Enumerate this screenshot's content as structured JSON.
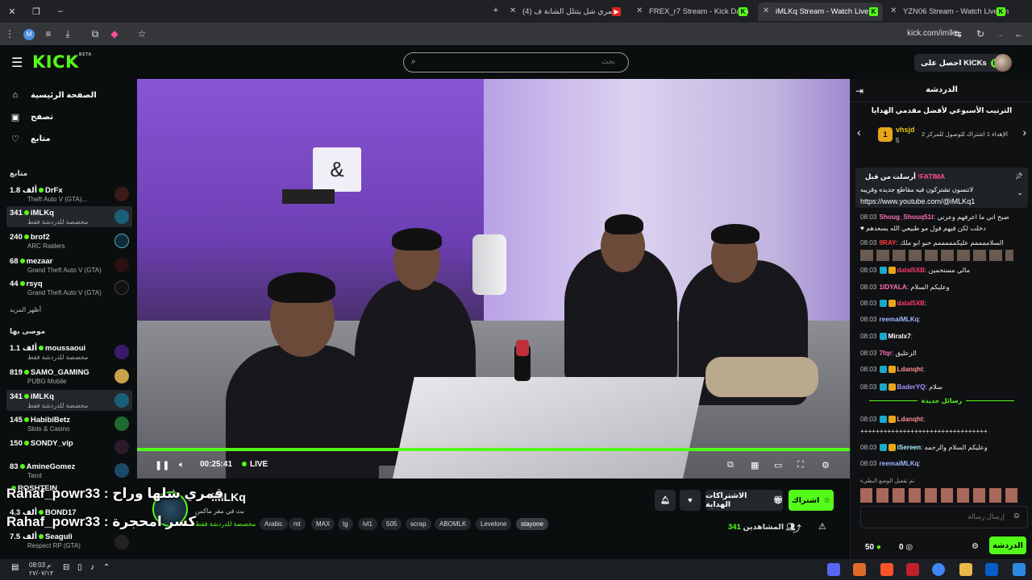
{
  "browser": {
    "tabs": [
      {
        "title": "قمري شل يتتلل الشانة ف (4)",
        "active": false
      },
      {
        "title": "FREX_r7 Stream - Kick Dash",
        "active": false
      },
      {
        "title": "iMLKq Stream - Watch Live",
        "active": true
      },
      {
        "title": "YZN06 Stream - Watch Live on",
        "active": false
      }
    ],
    "url": "kick.com/imlkq",
    "profile_initial": "M"
  },
  "header": {
    "logo": "KICK",
    "logo_beta": "BETA",
    "search_placeholder": "بحث",
    "get_kicks": "احصل على KICKs"
  },
  "sidebar": {
    "nav": [
      {
        "label": "الصفحة الرئيسية",
        "icon": "home-icon"
      },
      {
        "label": "تصفح",
        "icon": "browse-icon"
      },
      {
        "label": "متابع",
        "icon": "heart-icon"
      }
    ],
    "following_title": "متابع",
    "following": [
      {
        "viewers": "1.8 ألف",
        "name": "DrFx",
        "game": "Theft Auto V (GTA)...",
        "live": true
      },
      {
        "viewers": "341",
        "name": "iMLKq",
        "game": "مخصصة للدردشة فقط",
        "live": true,
        "selected": true
      },
      {
        "viewers": "240",
        "name": "brof2",
        "game": "ARC Raiders",
        "live": true
      },
      {
        "viewers": "68",
        "name": "mezaar",
        "game": "Grand Theft Auto V (GTA)",
        "live": true
      },
      {
        "viewers": "44",
        "name": "rsyq",
        "game": "Grand Theft Auto V (GTA)",
        "live": true
      }
    ],
    "show_more": "أظهر المزيد",
    "recommended_title": "موصى بها",
    "recommended": [
      {
        "viewers": "1.1 ألف",
        "name": "moussaoui",
        "game": "مخصصة للدردشة فقط"
      },
      {
        "viewers": "819",
        "name": "SAMO_GAMING",
        "game": "PUBG Mobile"
      },
      {
        "viewers": "341",
        "name": "iMLKq",
        "game": "مخصصة للدردشة فقط",
        "selected": true
      },
      {
        "viewers": "145",
        "name": "HabibiBetz",
        "game": "Slots & Casino"
      },
      {
        "viewers": "150",
        "name": "SONDY_vip",
        "game": ""
      },
      {
        "viewers": "83",
        "name": "AmineGomez",
        "game": "Tarot"
      },
      {
        "viewers": "",
        "name": "ROSHTEIN",
        "game": ""
      },
      {
        "viewers": "4.3 ألف",
        "name": "BOND17",
        "game": ""
      },
      {
        "viewers": "7.5 ألف",
        "name": "Seaguli",
        "game": "Respect RP (GTA)"
      }
    ]
  },
  "player": {
    "time": "00:25:41",
    "live_label": "LIVE",
    "progress": 1.0
  },
  "overlay": {
    "line1": "Rahaf_powr33 : قمري شلها وراح",
    "line2": "Rahaf_powr33 : كسر امحجرة"
  },
  "stream": {
    "channel": "iMLKq",
    "subtitle": "بث في مقر ماكس",
    "category": "مخصصة للدردشة فقط",
    "tags": [
      "Arabic",
      "mt",
      "MAX",
      "tg",
      "lvl1",
      "505",
      "scrap",
      "ABOMLK",
      "Levelone",
      "stayone"
    ],
    "subscribe": "اشتراك",
    "gift_subs": "الاشتراكات الهداية",
    "viewers_count": "341",
    "viewers_label": "المشاهدين"
  },
  "chat": {
    "title": "الدردشة",
    "leaderboard_title": "الترتيب الأسبوعي لأفضل مقدمي الهدايا",
    "top_gifter": "vhsjd",
    "top_gifter_count": "5",
    "rank_text": "الإهداء 1 اشتراك للوصول للمركز 2",
    "pinned_user": "!FATIMA",
    "pinned_by": "أرسلت من قبل",
    "pinned_text": "لاتنسون تشتركون فيه مقاطع جديده وقريبه",
    "pinned_link": "https://www.youtube.com/@iMLKq1",
    "messages": [
      {
        "time": "08:03",
        "user": "Shoug_Shouq51t",
        "text": "صبح اني ما اعرفهم وعرني",
        "color": "#ff6fb5"
      },
      {
        "time": "",
        "user": "",
        "text": "♥ دخلت لكن فيهم فول مو طبيعي الله يسعدهم",
        "color": "#fff"
      },
      {
        "time": "08:03",
        "user": "9RAY",
        "text": "السلاممممم عليكمممممم حبو ابو ملك",
        "color": "#ff3b3b"
      },
      {
        "time": "08:03",
        "user": "dalal5XB",
        "text": "مالي مستحمين",
        "color": "#ff3b6b"
      },
      {
        "time": "08:03",
        "user": "1IDYALA",
        "text": "وعليكم السلام",
        "color": "#ff6fb5"
      },
      {
        "time": "08:03",
        "user": "dalal5XB",
        "text": "",
        "color": "#ff3b6b"
      },
      {
        "time": "08:03",
        "user": "reemaiMLKq",
        "text": "",
        "color": "#9fb6ff"
      },
      {
        "time": "08:03",
        "user": "Miralx7",
        "text": "",
        "color": "#fff"
      },
      {
        "time": "08:03",
        "user": "7fqr",
        "text": "الزعليق",
        "color": "#ff6fb5"
      },
      {
        "time": "08:03",
        "user": "Ldanqht",
        "text": "",
        "color": "#ff8f8f"
      },
      {
        "time": "08:03",
        "user": "BaderYQ",
        "text": "سلام",
        "color": "#a98fff"
      }
    ],
    "new_messages": "رسائل جديدة",
    "new": [
      {
        "time": "08:03",
        "user": "Ldanqht",
        "text": "",
        "color": "#ff8f8f"
      },
      {
        "time": "",
        "user": "",
        "text": "+++++++++++++++++++++++++++++++++",
        "color": "#fff"
      },
      {
        "time": "08:03",
        "user": "iSereen",
        "text": "وعليكم السلام والرحمه",
        "color": "#aef"
      },
      {
        "time": "08:03",
        "user": "reemaiMLKq",
        "text": "",
        "color": "#9fb6ff"
      }
    ],
    "unpin_note": "تم تفعيل الوضع البطيء",
    "input_placeholder": "إرسال رسالة",
    "kicks_count": "50",
    "coin_count": "0",
    "chat_button": "الدردشة"
  },
  "taskbar": {
    "time": "08:03 م",
    "date": "٢٧/٠٧/١٣"
  }
}
